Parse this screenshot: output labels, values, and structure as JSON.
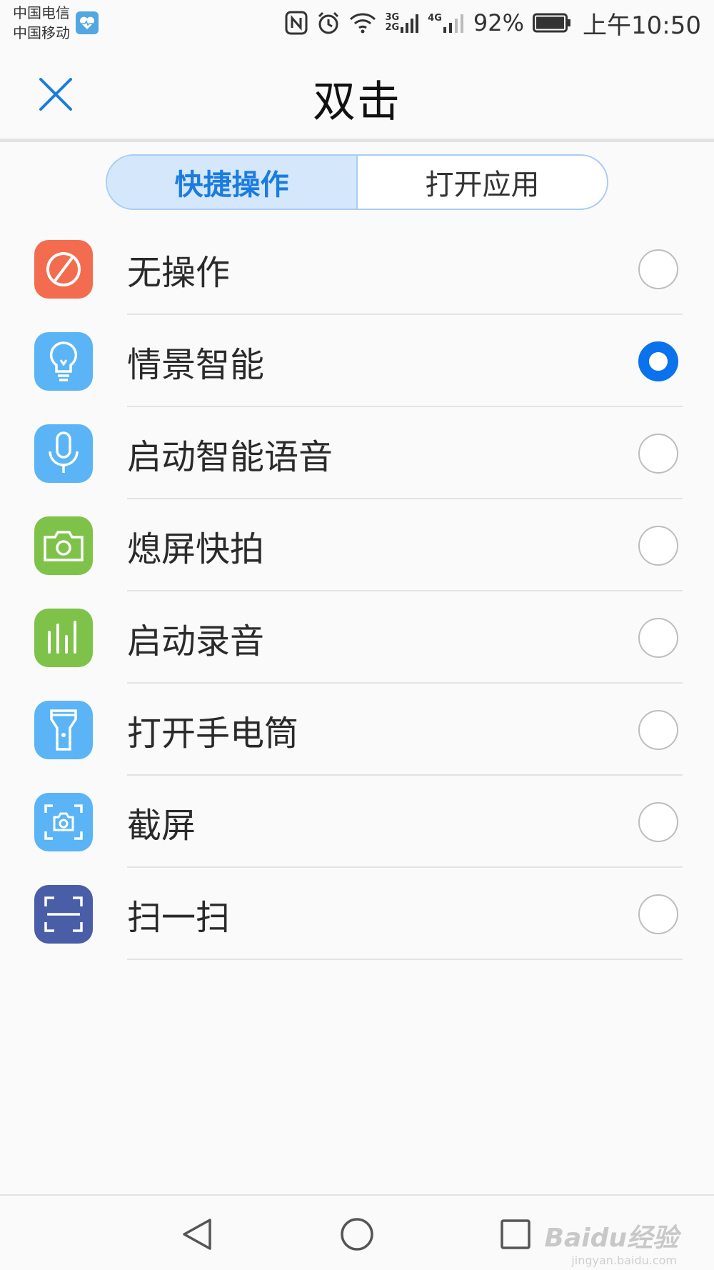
{
  "status_bar": {
    "carrier_1": "中国电信",
    "carrier_2": "中国移动",
    "network_1": "3G",
    "network_2": "2G",
    "network_3": "4G",
    "battery": "92%",
    "time": "上午10:50"
  },
  "header": {
    "title": "双击"
  },
  "tabs": [
    {
      "label": "快捷操作",
      "active": true
    },
    {
      "label": "打开应用",
      "active": false
    }
  ],
  "options": [
    {
      "label": "无操作",
      "icon": "prohibit-icon",
      "color": "#f36c4f",
      "selected": false
    },
    {
      "label": "情景智能",
      "icon": "lightbulb-icon",
      "color": "#5ab4f5",
      "selected": true
    },
    {
      "label": "启动智能语音",
      "icon": "microphone-icon",
      "color": "#5ab4f5",
      "selected": false
    },
    {
      "label": "熄屏快拍",
      "icon": "camera-icon",
      "color": "#7ec24a",
      "selected": false
    },
    {
      "label": "启动录音",
      "icon": "sound-bars-icon",
      "color": "#7ec24a",
      "selected": false
    },
    {
      "label": "打开手电筒",
      "icon": "flashlight-icon",
      "color": "#5ab4f5",
      "selected": false
    },
    {
      "label": "截屏",
      "icon": "screenshot-icon",
      "color": "#5ab4f5",
      "selected": false
    },
    {
      "label": "扫一扫",
      "icon": "scan-icon",
      "color": "#4a5ea8",
      "selected": false
    }
  ],
  "watermark": {
    "brand": "Baidu经验",
    "url": "jingyan.baidu.com"
  },
  "colors": {
    "accent": "#0a72ec",
    "tab_active_bg": "#d4e7fb"
  }
}
